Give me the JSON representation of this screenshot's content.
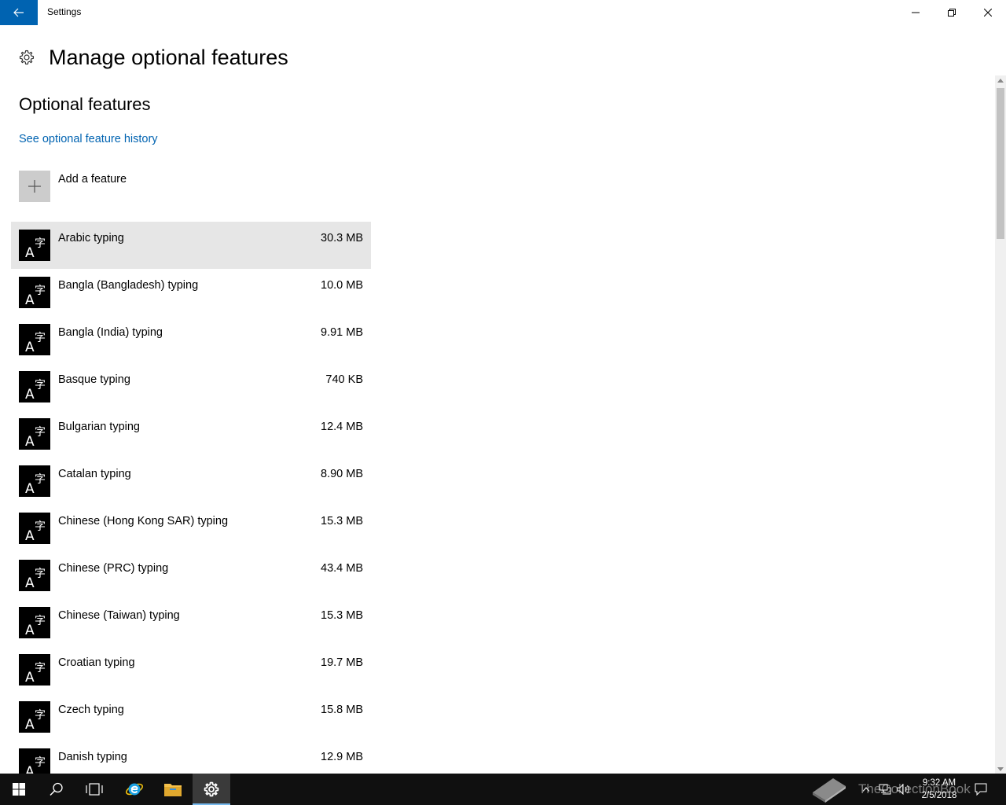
{
  "window": {
    "title": "Settings"
  },
  "header": {
    "title": "Manage optional features"
  },
  "section": {
    "title": "Optional features",
    "history_link": "See optional feature history",
    "add_feature": "Add a feature"
  },
  "features": [
    {
      "name": "Arabic typing",
      "size": "30.3 MB"
    },
    {
      "name": "Bangla (Bangladesh) typing",
      "size": "10.0 MB"
    },
    {
      "name": "Bangla (India) typing",
      "size": "9.91 MB"
    },
    {
      "name": "Basque typing",
      "size": "740 KB"
    },
    {
      "name": "Bulgarian typing",
      "size": "12.4 MB"
    },
    {
      "name": "Catalan typing",
      "size": "8.90 MB"
    },
    {
      "name": "Chinese (Hong Kong SAR) typing",
      "size": "15.3 MB"
    },
    {
      "name": "Chinese (PRC) typing",
      "size": "43.4 MB"
    },
    {
      "name": "Chinese (Taiwan) typing",
      "size": "15.3 MB"
    },
    {
      "name": "Croatian typing",
      "size": "19.7 MB"
    },
    {
      "name": "Czech typing",
      "size": "15.8 MB"
    },
    {
      "name": "Danish typing",
      "size": "12.9 MB"
    }
  ],
  "feature_icon_glyphs": {
    "latin": "A",
    "cjk": "字"
  },
  "taskbar": {
    "watermark": "TheCollectionBook",
    "time": "9:32 AM",
    "date": "2/5/2018"
  },
  "colors": {
    "accent": "#0063b1",
    "selected_row": "#e6e6e6",
    "taskbar": "#101010"
  },
  "icons": {
    "back": "back-arrow-icon",
    "settings": "gear-icon",
    "add": "plus-icon",
    "feature": "language-typing-icon"
  }
}
